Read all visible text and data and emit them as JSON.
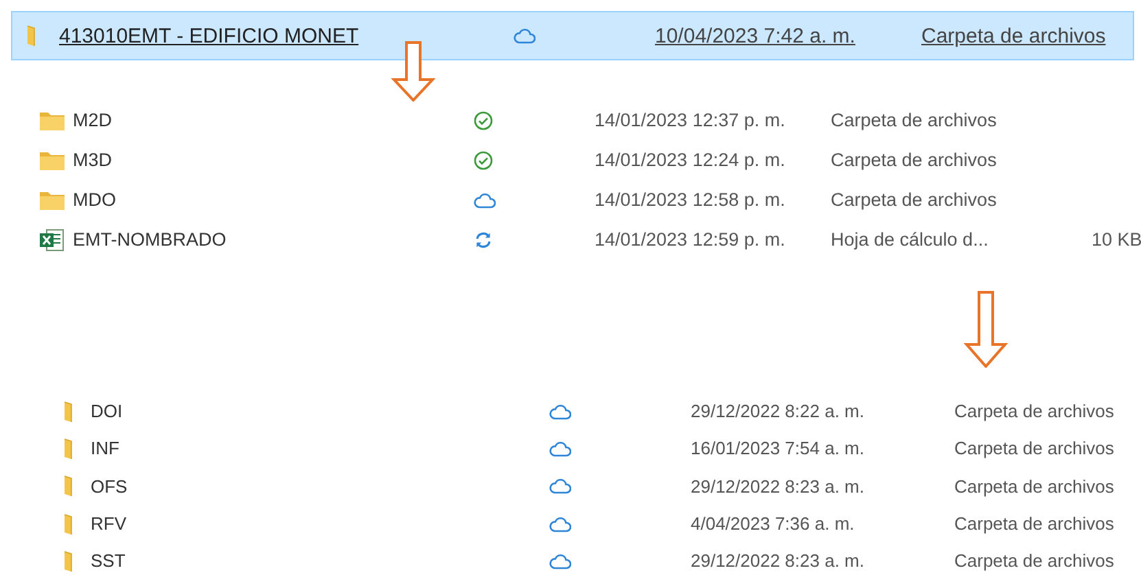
{
  "header": {
    "name": "413010EMT - EDIFICIO MONET",
    "status": {
      "kind": "cloud"
    },
    "date": "10/04/2023 7:42 a. m.",
    "type": "Carpeta de archivos",
    "selected": true
  },
  "group_1": [
    {
      "kind": "folder",
      "name": "M2D",
      "status": {
        "kind": "synced"
      },
      "date": "14/01/2023 12:37 p. m.",
      "type": "Carpeta de archivos"
    },
    {
      "kind": "folder",
      "name": "M3D",
      "status": {
        "kind": "synced"
      },
      "date": "14/01/2023 12:24 p. m.",
      "type": "Carpeta de archivos"
    },
    {
      "kind": "folder",
      "name": "MDO",
      "status": {
        "kind": "cloud"
      },
      "date": "14/01/2023 12:58 p. m.",
      "type": "Carpeta de archivos"
    },
    {
      "kind": "spreadsheet",
      "name": "EMT-NOMBRADO",
      "status": {
        "kind": "syncing"
      },
      "date": "14/01/2023 12:59 p. m.",
      "type": "Hoja de cálculo d...",
      "size": "10 KB"
    }
  ],
  "group_2": [
    {
      "kind": "folder",
      "name": "DOI",
      "status": {
        "kind": "cloud"
      },
      "date": "29/12/2022 8:22 a. m.",
      "type": "Carpeta de archivos"
    },
    {
      "kind": "folder",
      "name": "INF",
      "status": {
        "kind": "cloud"
      },
      "date": "16/01/2023 7:54 a. m.",
      "type": "Carpeta de archivos"
    },
    {
      "kind": "folder",
      "name": "OFS",
      "status": {
        "kind": "cloud"
      },
      "date": "29/12/2022 8:23 a. m.",
      "type": "Carpeta de archivos"
    },
    {
      "kind": "folder",
      "name": "RFV",
      "status": {
        "kind": "cloud"
      },
      "date": "4/04/2023 7:36 a. m.",
      "type": "Carpeta de archivos"
    },
    {
      "kind": "folder",
      "name": "SST",
      "status": {
        "kind": "cloud"
      },
      "date": "29/12/2022 8:23 a. m.",
      "type": "Carpeta de archivos"
    }
  ]
}
